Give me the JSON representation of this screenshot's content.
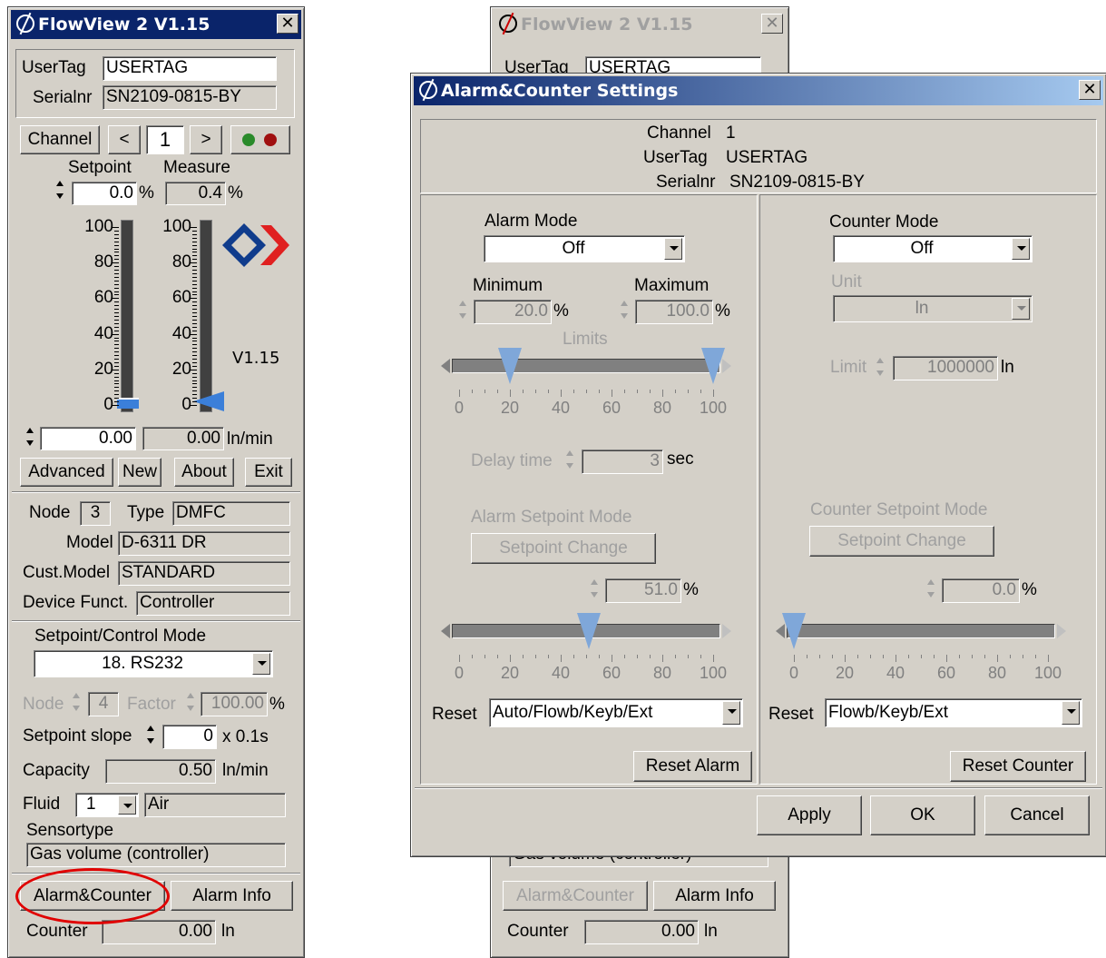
{
  "main_window": {
    "title": "FlowView 2 V1.15",
    "usertag_label": "UserTag",
    "usertag_value": "USERTAG",
    "serial_label": "Serialnr",
    "serial_value": "SN2109-0815-BY",
    "channel_button": "Channel",
    "prev_button": "<",
    "channel_value": "1",
    "next_button": ">",
    "setpoint_label": "Setpoint",
    "measure_label": "Measure",
    "setpoint_pct": "0.0",
    "measure_pct": "0.4",
    "pct_unit": "%",
    "scale_labels": [
      "100",
      "80",
      "60",
      "40",
      "20",
      "0"
    ],
    "version": "V1.15",
    "setpoint_abs": "0.00",
    "measure_abs": "0.00",
    "flow_unit": "ln/min",
    "buttons": {
      "advanced": "Advanced",
      "new": "New",
      "about": "About",
      "exit": "Exit"
    },
    "node_label": "Node",
    "node_value": "3",
    "type_label": "Type",
    "type_value": "DMFC",
    "model_label": "Model",
    "model_value": "D-6311 DR",
    "cust_model_label": "Cust.Model",
    "cust_model_value": "STANDARD",
    "device_funct_label": "Device Funct.",
    "device_funct_value": "Controller",
    "control_mode_label": "Setpoint/Control Mode",
    "control_mode_value": "18. RS232",
    "node2_label": "Node",
    "node2_value": "4",
    "factor_label": "Factor",
    "factor_value": "100.00",
    "slope_label": "Setpoint slope",
    "slope_value": "0",
    "slope_unit": "x 0.1s",
    "capacity_label": "Capacity",
    "capacity_value": "0.50",
    "capacity_unit": "ln/min",
    "fluid_label": "Fluid",
    "fluid_number": "1",
    "fluid_name": "Air",
    "sensortype_label": "Sensortype",
    "sensortype_value": "Gas volume (controller)",
    "alarm_counter_button": "Alarm&Counter",
    "alarm_info_button": "Alarm Info",
    "counter_label": "Counter",
    "counter_value": "0.00",
    "counter_unit": "ln"
  },
  "back_window": {
    "title": "FlowView 2 V1.15",
    "usertag_label": "UserTag",
    "usertag_value": "USERTAG",
    "sensortype_value": "Gas volume (controller)",
    "alarm_counter_button": "Alarm&Counter",
    "alarm_info_button": "Alarm Info",
    "counter_label": "Counter",
    "counter_value": "0.00",
    "counter_unit": "ln"
  },
  "dialog": {
    "title": "Alarm&Counter Settings",
    "channel_label": "Channel",
    "channel_value": "1",
    "usertag_label": "UserTag",
    "usertag_value": "USERTAG",
    "serial_label": "Serialnr",
    "serial_value": "SN2109-0815-BY",
    "alarm": {
      "mode_label": "Alarm Mode",
      "mode_value": "Off",
      "minimum_label": "Minimum",
      "minimum_value": "20.0",
      "maximum_label": "Maximum",
      "maximum_value": "100.0",
      "pct_unit": "%",
      "limits_label": "Limits",
      "limit_min_fraction": 0.2,
      "limit_max_fraction": 1.0,
      "scale_labels": [
        "0",
        "20",
        "40",
        "60",
        "80",
        "100"
      ],
      "delay_label": "Delay time",
      "delay_value": "3",
      "delay_unit": "sec",
      "setpoint_mode_label": "Alarm Setpoint Mode",
      "setpoint_change_button": "Setpoint Change",
      "setpoint_value": "51.0",
      "setpoint_fraction": 0.51,
      "reset_label": "Reset",
      "reset_value": "Auto/Flowb/Keyb/Ext",
      "reset_button": "Reset Alarm"
    },
    "counter": {
      "mode_label": "Counter Mode",
      "mode_value": "Off",
      "unit_label": "Unit",
      "unit_value": "ln",
      "limit_label": "Limit",
      "limit_value": "1000000",
      "limit_unit": "ln",
      "setpoint_mode_label": "Counter Setpoint Mode",
      "setpoint_change_button": "Setpoint Change",
      "setpoint_value": "0.0",
      "setpoint_fraction": 0.0,
      "pct_unit": "%",
      "scale_labels": [
        "0",
        "20",
        "40",
        "60",
        "80",
        "100"
      ],
      "reset_label": "Reset",
      "reset_value": "Flowb/Keyb/Ext",
      "reset_button": "Reset Counter"
    },
    "apply_button": "Apply",
    "ok_button": "OK",
    "cancel_button": "Cancel"
  },
  "colors": {
    "title_active": "#0a246a",
    "face": "#d4d0c8",
    "highlight_circle": "#e00000",
    "slider_thumb": "#7fa7d9",
    "led_green": "#2a8a2a",
    "led_red": "#a01010",
    "logo_blue": "#103c8c",
    "logo_red": "#e02020"
  }
}
